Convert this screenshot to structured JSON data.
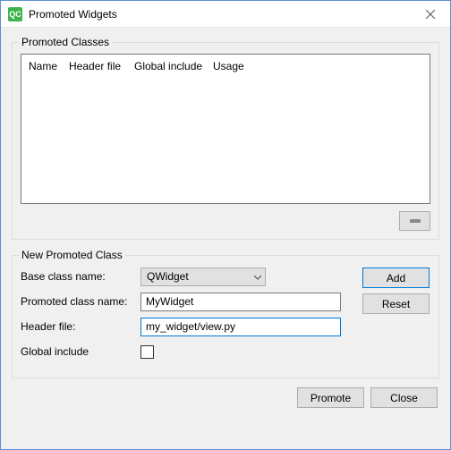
{
  "window": {
    "title": "Promoted Widgets",
    "app_icon_text": "QC"
  },
  "group1": {
    "title": "Promoted Classes",
    "columns": [
      "Name",
      "Header file",
      "Global include",
      "Usage"
    ]
  },
  "group2": {
    "title": "New Promoted Class",
    "base_label": "Base class name:",
    "base_value": "QWidget",
    "promoted_label": "Promoted class name:",
    "promoted_value": "MyWidget",
    "header_label": "Header file:",
    "header_value": "my_widget/view.py",
    "global_label": "Global include",
    "add_label": "Add",
    "reset_label": "Reset"
  },
  "footer": {
    "promote_label": "Promote",
    "close_label": "Close"
  }
}
